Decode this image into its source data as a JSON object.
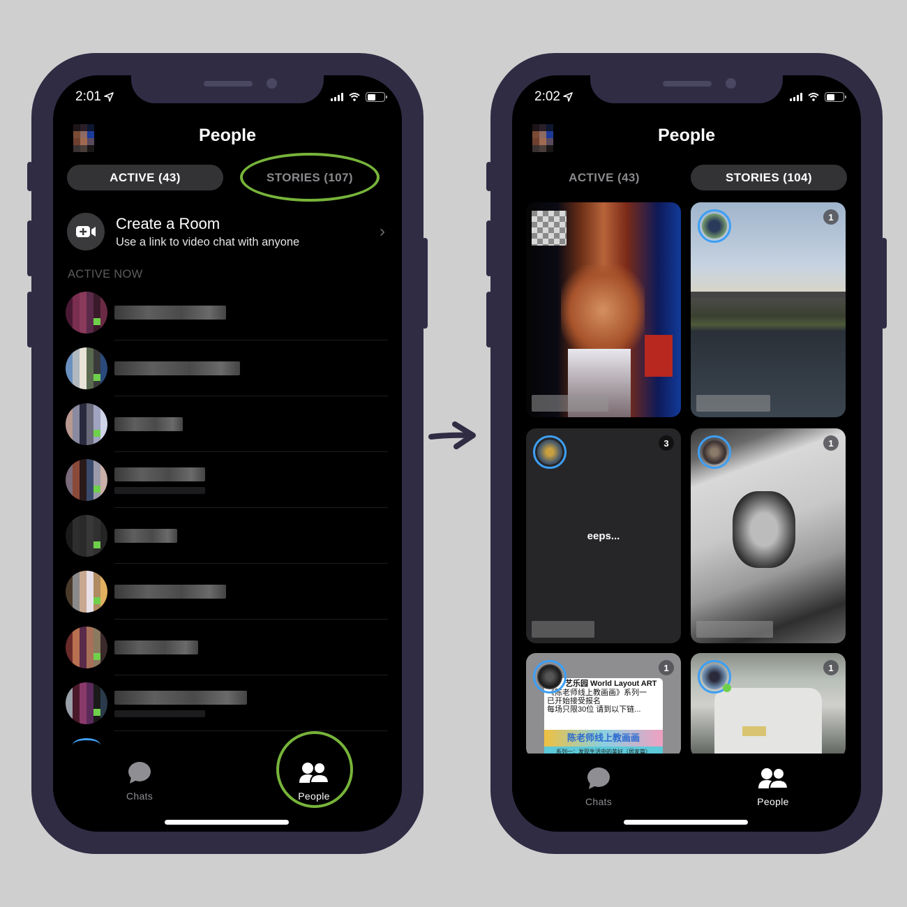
{
  "colors": {
    "frame": "#2f2c44",
    "background": "#cfcfcf",
    "highlight": "#77b43a",
    "story_ring": "#3d9ff5",
    "presence": "#6fd04b"
  },
  "left_screen": {
    "status": {
      "time": "2:01",
      "location_icon": "location-arrow-icon",
      "signal_icon": "cellular-signal-icon",
      "wifi_icon": "wifi-icon",
      "battery_icon": "battery-icon"
    },
    "header": {
      "title": "People",
      "profile_icon": "profile-avatar"
    },
    "tabs": [
      {
        "label": "ACTIVE (43)",
        "selected": true
      },
      {
        "label": "STORIES (107)",
        "selected": false,
        "highlighted": true
      }
    ],
    "create_room": {
      "icon": "video-plus-icon",
      "title": "Create a Room",
      "subtitle": "Use a link to video chat with anyone",
      "chevron_icon": "chevron-right-icon"
    },
    "section_label": "ACTIVE NOW",
    "contacts": [
      {
        "name": "[blurred]",
        "online": true,
        "has_subtitle": false
      },
      {
        "name": "[blurred]",
        "online": true,
        "has_subtitle": false
      },
      {
        "name": "[blurred]",
        "online": true,
        "has_subtitle": false
      },
      {
        "name": "[blurred]",
        "online": true,
        "has_subtitle": true
      },
      {
        "name": "[blurred]",
        "online": true,
        "has_subtitle": false
      },
      {
        "name": "[blurred]",
        "online": true,
        "has_subtitle": false
      },
      {
        "name": "[blurred]",
        "online": true,
        "has_subtitle": false
      },
      {
        "name": "[blurred]",
        "online": true,
        "has_subtitle": true
      }
    ],
    "tabbar": [
      {
        "label": "Chats",
        "icon": "chat-bubble-icon",
        "selected": false
      },
      {
        "label": "People",
        "icon": "people-icon",
        "selected": true,
        "highlighted": true
      }
    ]
  },
  "right_screen": {
    "status": {
      "time": "2:02",
      "location_icon": "location-arrow-icon",
      "signal_icon": "cellular-signal-icon",
      "wifi_icon": "wifi-icon",
      "battery_icon": "battery-icon"
    },
    "header": {
      "title": "People",
      "profile_icon": "profile-avatar"
    },
    "tabs": [
      {
        "label": "ACTIVE (43)",
        "selected": false
      },
      {
        "label": "STORIES (104)",
        "selected": true
      }
    ],
    "stories": [
      {
        "type": "own-story",
        "count": null,
        "text": "",
        "name": "[blurred]"
      },
      {
        "type": "photo",
        "scene": "bridge over river",
        "count": "1",
        "text": "",
        "name": "[blurred]"
      },
      {
        "type": "text",
        "count": "3",
        "text": "eeps...",
        "name": "[blurred]"
      },
      {
        "type": "photo",
        "scene": "sketch of bearded man",
        "count": "1",
        "text": "",
        "name": "[blurred]"
      },
      {
        "type": "shared-post",
        "count": "1",
        "post_title": "艺乐园 World Layout ART",
        "post_body": [
          "《陈老师线上教画画》系列一",
          "已开始接受报名",
          "每场只限30位  请到以下链..."
        ],
        "banner_title": "陈老师线上教画画",
        "banner_sub": "系列一：发现生活中的美好（居家篇）"
      },
      {
        "type": "photo",
        "scene": "car in rain",
        "count": "1",
        "text": "",
        "online": true
      }
    ],
    "tabbar": [
      {
        "label": "Chats",
        "icon": "chat-bubble-icon",
        "selected": false
      },
      {
        "label": "People",
        "icon": "people-icon",
        "selected": true
      }
    ]
  },
  "transition_arrow": "arrow-right-icon"
}
